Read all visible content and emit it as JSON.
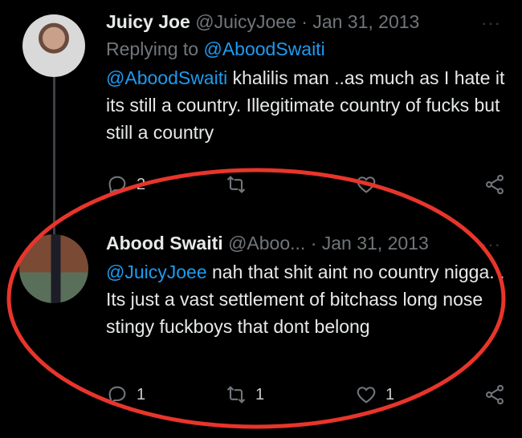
{
  "tweet1": {
    "name": "Juicy Joe",
    "handle": "@JuicyJoee",
    "sep": "·",
    "date": "Jan 31, 2013",
    "replying_prefix": "Replying to ",
    "replying_to": "@AboodSwaiti",
    "body_mention": "@AboodSwaiti",
    "body_text": " khalilis man ..as much as I hate it its still a country. Illegitimate country of fucks but still a country",
    "reply_count": "2",
    "retweet_count": "",
    "like_count": ""
  },
  "tweet2": {
    "name": "Abood Swaiti",
    "handle": "@Aboo...",
    "sep": "·",
    "date": "Jan 31, 2013",
    "body_mention": "@JuicyJoee",
    "body_text": " nah that shit aint no country nigga. . Its just a vast settlement of bitchass long nose stingy fuckboys that dont belong",
    "reply_count": "1",
    "retweet_count": "1",
    "like_count": "1"
  },
  "icons": {
    "more": "more-icon",
    "reply": "reply-icon",
    "retweet": "retweet-icon",
    "like": "heart-icon",
    "share": "share-icon"
  },
  "colors": {
    "background": "#000000",
    "text": "#e7e9ea",
    "muted": "#71767b",
    "mention": "#1d9bf0",
    "highlight_oval": "#e8352b"
  }
}
